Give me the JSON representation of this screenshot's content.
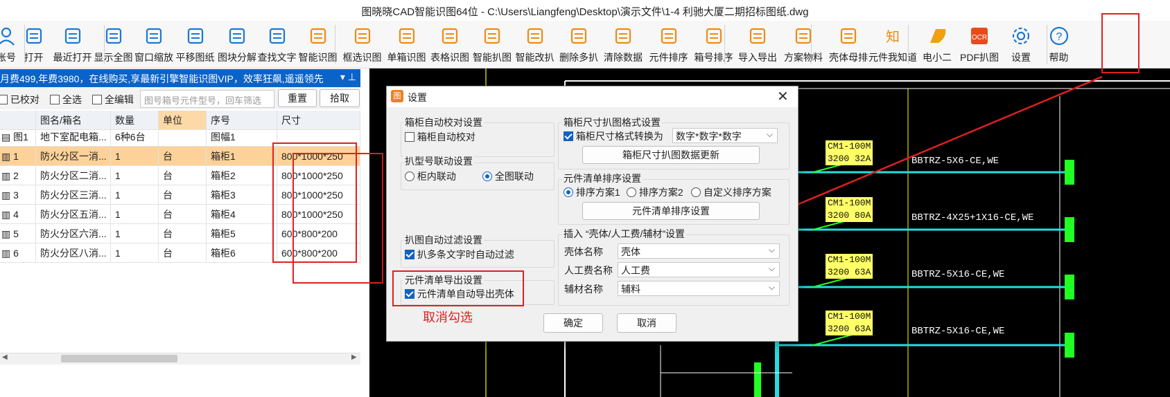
{
  "window": {
    "title": "图晓晓CAD智能识图64位 - C:\\Users\\Liangfeng\\Desktop\\演示文件\\1-4 利驰大厦二期招标图纸.dwg"
  },
  "toolbar": [
    {
      "label": "账号",
      "icon": "user-icon"
    },
    {
      "label": "打开",
      "icon": "folder-open-icon"
    },
    {
      "label": "最近打开",
      "icon": "recent-folder-icon"
    },
    {
      "label": "显示全图",
      "icon": "zoom-extents-icon"
    },
    {
      "label": "窗口缩放",
      "icon": "zoom-window-icon"
    },
    {
      "label": "平移图纸",
      "icon": "pan-icon"
    },
    {
      "label": "图块分解",
      "icon": "explode-block-icon"
    },
    {
      "label": "查找文字",
      "icon": "find-text-icon"
    },
    {
      "label": "智能识图",
      "icon": "ai-recognize-icon"
    },
    {
      "label": "框选识图",
      "icon": "box-select-icon"
    },
    {
      "label": "单箱识图",
      "icon": "single-box-icon"
    },
    {
      "label": "表格识图",
      "icon": "table-recognize-icon"
    },
    {
      "label": "智能扒图",
      "icon": "smart-extract-icon"
    },
    {
      "label": "智能改扒",
      "icon": "smart-modify-icon"
    },
    {
      "label": "删除多扒",
      "icon": "delete-extra-icon"
    },
    {
      "label": "清除数据",
      "icon": "clear-data-icon"
    },
    {
      "label": "元件排序",
      "icon": "component-sort-icon"
    },
    {
      "label": "箱号排序",
      "icon": "box-sort-icon"
    },
    {
      "label": "导入导出",
      "icon": "import-export-icon"
    },
    {
      "label": "方案物料",
      "icon": "material-icon"
    },
    {
      "label": "壳体母排",
      "icon": "shell-busbar-icon"
    },
    {
      "label": "元件我知道",
      "icon": "knowledge-icon"
    },
    {
      "label": "电小二",
      "icon": "dianxiaoer-icon"
    },
    {
      "label": "PDF扒图",
      "icon": "pdf-ocr-icon"
    },
    {
      "label": "设置",
      "icon": "gear-icon"
    },
    {
      "label": "帮助",
      "icon": "help-icon"
    }
  ],
  "left_panel": {
    "banner": "月费499,年费3980，在线购买,享最新引擎智能识图VIP，效率狂飙,遥遥领先",
    "filters": {
      "checked_label": "已校对",
      "select_all_label": "全选",
      "edit_all_label": "全编辑",
      "search_placeholder": "图号箱号元件型号，回车筛选",
      "reset_label": "重置",
      "pick_label": "拾取"
    },
    "columns": [
      "图名/箱名",
      "数量",
      "单位",
      "序号",
      "尺寸"
    ],
    "rows": [
      {
        "no": "图1",
        "name": "地下室配电箱...",
        "qty": "6种6台",
        "unit": "",
        "seq": "图幅1",
        "size": ""
      },
      {
        "no": "1",
        "name": "防火分区一消...",
        "qty": "1",
        "unit": "台",
        "seq": "箱柜1",
        "size": "800*1000*250"
      },
      {
        "no": "2",
        "name": "防火分区二消...",
        "qty": "1",
        "unit": "台",
        "seq": "箱柜2",
        "size": "800*1000*250"
      },
      {
        "no": "3",
        "name": "防火分区三消...",
        "qty": "1",
        "unit": "台",
        "seq": "箱柜3",
        "size": "800*1000*250"
      },
      {
        "no": "4",
        "name": "防火分区五消...",
        "qty": "1",
        "unit": "台",
        "seq": "箱柜4",
        "size": "800*1000*250"
      },
      {
        "no": "5",
        "name": "防火分区六消...",
        "qty": "1",
        "unit": "台",
        "seq": "箱柜5",
        "size": "600*800*200"
      },
      {
        "no": "6",
        "name": "防火分区八消...",
        "qty": "1",
        "unit": "台",
        "seq": "箱柜6",
        "size": "600*800*200"
      }
    ]
  },
  "dialog": {
    "title": "设置",
    "g1_title": "箱柜自动校对设置",
    "g1_check": "箱柜自动校对",
    "g2_title": "扒型号联动设置",
    "g2_opt1": "柜内联动",
    "g2_opt2": "全图联动",
    "g3_title": "扒图自动过滤设置",
    "g3_check": "扒多条文字时自动过滤",
    "g4_title": "元件清单导出设置",
    "g4_check": "元件清单自动导出壳体",
    "g5_title": "箱柜尺寸扒图格式设置",
    "g5_check": "箱柜尺寸格式转换为",
    "g5_select": "数字*数字*数字",
    "g5_button": "箱柜尺寸扒图数据更新",
    "g6_title": "元件清单排序设置",
    "g6_opt1": "排序方案1",
    "g6_opt2": "排序方案2",
    "g6_opt3": "自定义排序方案",
    "g6_button": "元件清单排序设置",
    "g7_title": "插入 “壳体/人工费/辅材”设置",
    "g7_shell_label": "壳体名称",
    "g7_shell_value": "壳体",
    "g7_labor_label": "人工费名称",
    "g7_labor_value": "人工费",
    "g7_aux_label": "辅材名称",
    "g7_aux_value": "辅料",
    "ok": "确定",
    "cancel": "取消"
  },
  "annotation": {
    "note": "取消勾选"
  },
  "cad": {
    "breakers": [
      {
        "l1": "CM1-100M",
        "l2": "3200 32A",
        "cable": "BBTRZ-5X6-CE,WE"
      },
      {
        "l1": "CM1-100M",
        "l2": "3200 80A",
        "cable": "BBTRZ-4X25+1X16-CE,WE"
      },
      {
        "l1": "CM1-100M",
        "l2": "3200 63A",
        "cable": "BBTRZ-5X16-CE,WE"
      },
      {
        "l1": "CM1-100M",
        "l2": "3200 63A",
        "cable": "BBTRZ-5X16-CE,WE"
      }
    ]
  },
  "colors": {
    "banner": "#0a63c9",
    "highlight_row": "#fdd29a",
    "annotation_red": "#e02020",
    "breaker": "#ffff66",
    "cyan": "#22e0e0"
  }
}
